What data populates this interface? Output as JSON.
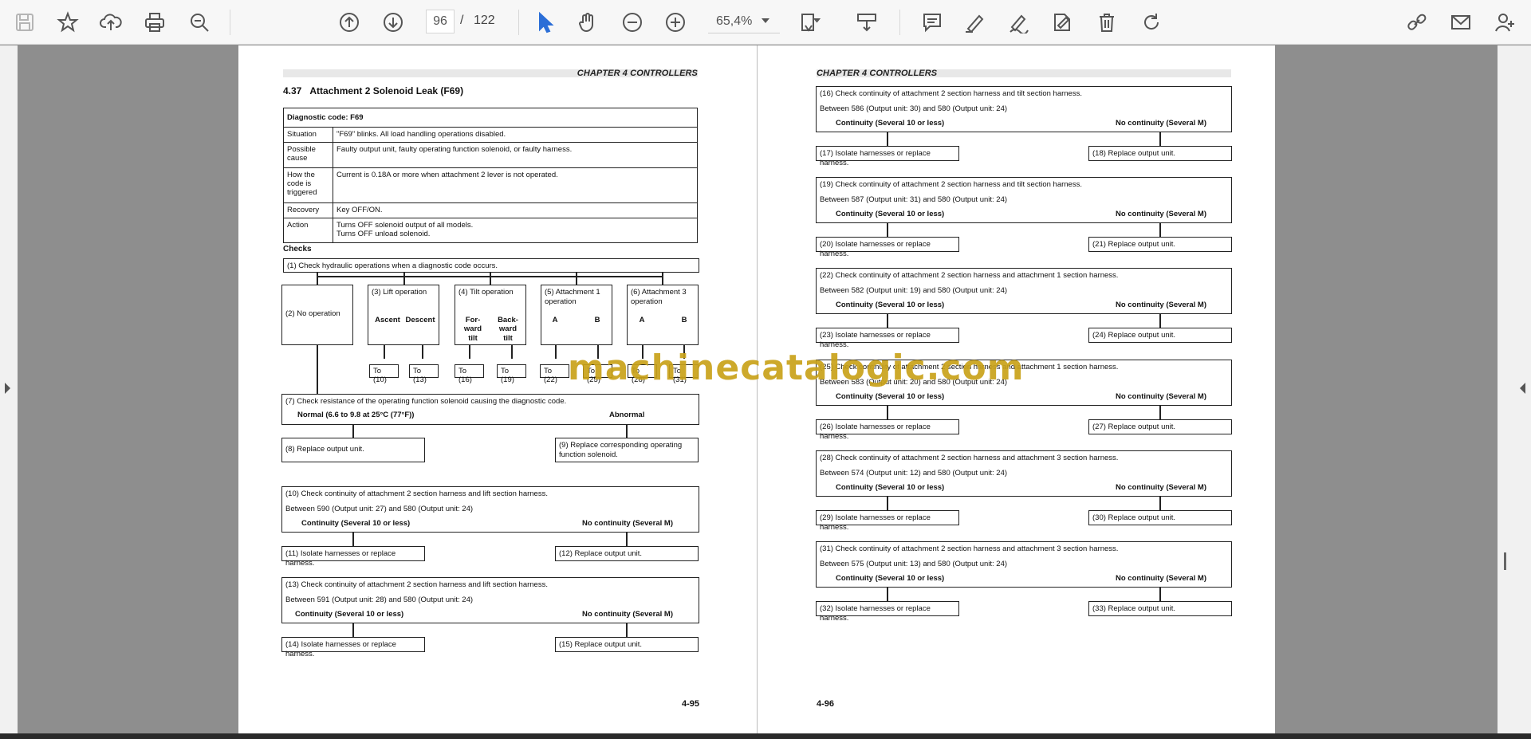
{
  "toolbar": {
    "current_page": "96",
    "page_separator": "/",
    "total_pages": "122",
    "zoom": "65,4%"
  },
  "left_page": {
    "chapter": "CHAPTER 4 CONTROLLERS",
    "section_number": "4.37",
    "section_title": "Attachment 2 Solenoid Leak (F69)",
    "diag_header": "Diagnostic code: F69",
    "diag_rows": [
      {
        "label": "Situation",
        "value": "\"F69\" blinks. All load handling operations disabled."
      },
      {
        "label": "Possible cause",
        "value": "Faulty output unit, faulty operating function solenoid, or faulty harness."
      },
      {
        "label": "How the code is triggered",
        "value": "Current is 0.18A or more when attachment 2 lever is not operated."
      },
      {
        "label": "Recovery",
        "value": "Key OFF/ON."
      },
      {
        "label": "Action",
        "value": "Turns OFF solenoid output of all models.\nTurns OFF unload solenoid."
      }
    ],
    "checks_label": "Checks",
    "check1": "(1) Check hydraulic operations when a diagnostic code occurs.",
    "op2": "(2) No operation",
    "op3": "(3) Lift operation",
    "op3_a": "Ascent",
    "op3_b": "Descent",
    "op4": "(4) Tilt operation",
    "op4_a": "For-\nward\ntilt",
    "op4_b": "Back-\nward\ntilt",
    "op5": "(5) Attachment 1 operation",
    "op5_a": "A",
    "op5_b": "B",
    "op6": "(6) Attachment 3 operation",
    "op6_a": "A",
    "op6_b": "B",
    "to_labels": [
      "To (10)",
      "To (13)",
      "To (16)",
      "To (19)",
      "To (22)",
      "To (25)",
      "To (28)",
      "To (31)"
    ],
    "check7": "(7) Check resistance of the operating function solenoid causing the diagnostic code.",
    "normal": "Normal (6.6 to 9.8 at 25°C (77°F))",
    "abnormal": "Abnormal",
    "box8": "(8) Replace output unit.",
    "box9": "(9) Replace corresponding operating function solenoid.",
    "check10_title": "(10) Check continuity of attachment 2 section harness and lift section harness.",
    "check10_between": "Between 590 (Output unit: 27) and 580 (Output unit: 24)",
    "check13_title": "(13) Check continuity of attachment 2 section harness and lift section harness.",
    "check13_between": "Between 591 (Output unit: 28) and 580 (Output unit: 24)",
    "continuity": "Continuity (Several 10 or less)",
    "no_continuity": "No continuity (Several M)",
    "box11": "(11) Isolate harnesses or replace harness.",
    "box12": "(12) Replace output unit.",
    "box14": "(14) Isolate harnesses or replace harness.",
    "box15": "(15) Replace output unit.",
    "page_number": "4-95"
  },
  "right_page": {
    "chapter": "CHAPTER 4 CONTROLLERS",
    "page_number": "4-96",
    "continuity": "Continuity (Several 10 or less)",
    "no_continuity": "No continuity (Several M)",
    "checks": [
      {
        "title": "(16) Check continuity of attachment 2 section harness and tilt section harness.",
        "between": "Between 586 (Output unit: 30) and 580 (Output unit: 24)",
        "left": "(17) Isolate harnesses or replace harness.",
        "right": "(18) Replace output unit."
      },
      {
        "title": "(19) Check continuity of attachment 2 section harness and tilt section harness.",
        "between": "Between 587 (Output unit: 31) and 580 (Output unit: 24)",
        "left": "(20) Isolate harnesses or replace harness.",
        "right": "(21) Replace output unit."
      },
      {
        "title": "(22) Check continuity of attachment 2 section harness and attachment 1 section harness.",
        "between": "Between 582 (Output unit: 19) and 580 (Output unit: 24)",
        "left": "(23) Isolate harnesses or replace harness.",
        "right": "(24) Replace output unit."
      },
      {
        "title": "(25) Check continuity of attachment 2 section harness and attachment 1 section harness.",
        "between": "Between 583 (Output unit: 20) and 580 (Output unit: 24)",
        "left": "(26) Isolate harnesses or replace harness.",
        "right": "(27) Replace output unit."
      },
      {
        "title": "(28) Check continuity of attachment 2 section harness and attachment 3 section harness.",
        "between": "Between 574 (Output unit: 12) and 580 (Output unit: 24)",
        "left": "(29) Isolate harnesses or replace harness.",
        "right": "(30) Replace output unit."
      },
      {
        "title": "(31) Check continuity of attachment 2 section harness and attachment 3 section harness.",
        "between": "Between 575 (Output unit: 13) and 580 (Output unit: 24)",
        "left": "(32) Isolate harnesses or replace harness.",
        "right": "(33) Replace output unit."
      }
    ]
  },
  "watermark": "machinecatalogic.com",
  "icons": [
    "save-icon",
    "bookmark-star-icon",
    "upload-icon",
    "print-icon",
    "zoom-search-icon",
    "page-up-icon",
    "page-down-icon",
    "select-cursor-icon",
    "hand-icon",
    "zoom-out-icon",
    "zoom-in-icon",
    "fit-page-icon",
    "scroll-mode-icon",
    "comment-icon",
    "highlight-icon",
    "draw-icon",
    "sign-icon",
    "delete-icon",
    "rotate-icon",
    "share-link-icon",
    "email-icon",
    "add-user-icon"
  ]
}
